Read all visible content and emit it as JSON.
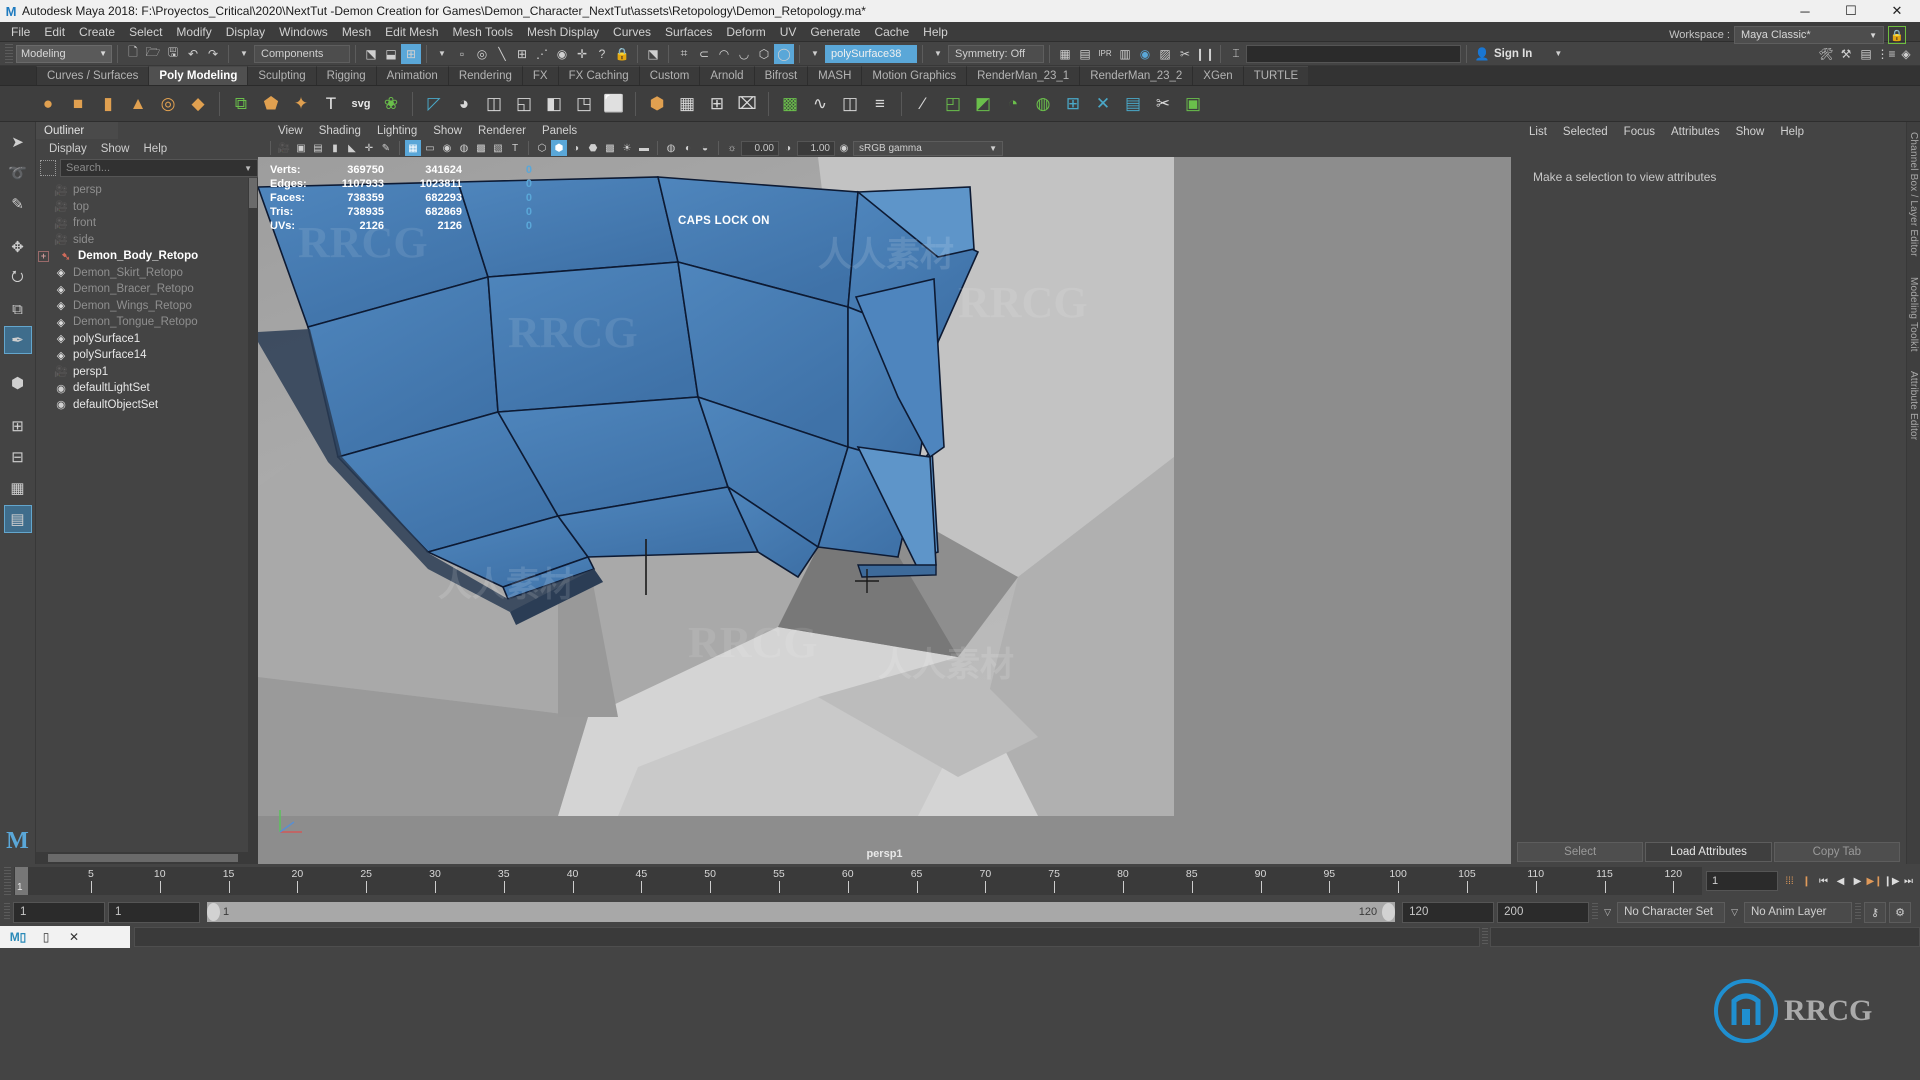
{
  "titlebar": {
    "icon": "maya-logo-icon",
    "text": "Autodesk Maya 2018: F:\\Proyectos_Critical\\2020\\NextTut -Demon Creation for Games\\Demon_Character_NextTut\\assets\\Retopology\\Demon_Retopology.ma*",
    "minimize": "─",
    "maximize": "☐",
    "close": "✕"
  },
  "menubar": {
    "items": [
      "File",
      "Edit",
      "Create",
      "Select",
      "Modify",
      "Display",
      "Windows",
      "Mesh",
      "Edit Mesh",
      "Mesh Tools",
      "Mesh Display",
      "Curves",
      "Surfaces",
      "Deform",
      "UV",
      "Generate",
      "Cache",
      "Help"
    ]
  },
  "statusline": {
    "menuset": "Modeling",
    "file_icons": [
      "new-file-icon",
      "open-file-icon",
      "save-file-icon",
      "undo-icon",
      "redo-icon"
    ],
    "selection_mode_label": "Components",
    "mask_icons": [
      "select-hierarchy-icon",
      "select-object-icon",
      "select-component-icon"
    ],
    "component_icons": [
      "points-icon",
      "circle-icon",
      "line-icon",
      "lattice-icon",
      "curve-point-icon",
      "target-icon",
      "plus-icon",
      "question-icon",
      "lock-icon"
    ],
    "snap_icons": [
      "snap-grid-icon",
      "snap-curve-icon",
      "snap-point-icon",
      "snap-projected-icon",
      "snap-view-plane-icon",
      "make-live-icon"
    ],
    "input_field": "polySurface38",
    "symmetry": "Symmetry: Off",
    "render_icons": [
      "render-current-frame-icon",
      "ipr-render-icon",
      "render-settings-icon",
      "hypershade-icon",
      "render-view-icon",
      "render-setup-icon",
      "pause-icon"
    ],
    "numeric_input_label": "numeric-input-field",
    "workspace_label": "Workspace :",
    "workspace_value": "Maya Classic*",
    "lock_icon": "lock-workspace-icon",
    "signin": "Sign In",
    "panel_icons": [
      "attribute-editor-icon",
      "tool-settings-icon",
      "channel-box-icon",
      "outliner-sidebar-icon",
      "layers-icon"
    ]
  },
  "shelf": {
    "tabs": [
      "Curves / Surfaces",
      "Poly Modeling",
      "Sculpting",
      "Rigging",
      "Animation",
      "Rendering",
      "FX",
      "FX Caching",
      "Custom",
      "Arnold",
      "Bifrost",
      "MASH",
      "Motion Graphics",
      "RenderMan_23_1",
      "RenderMan_23_2",
      "XGen",
      "TURTLE"
    ],
    "active_tab": "Poly Modeling",
    "icons": [
      {
        "name": "poly-sphere-icon",
        "glyph": "●",
        "color": "#e0a050"
      },
      {
        "name": "poly-cube-icon",
        "glyph": "■",
        "color": "#e0a050"
      },
      {
        "name": "poly-cylinder-icon",
        "glyph": "▮",
        "color": "#e0a050"
      },
      {
        "name": "poly-cone-icon",
        "glyph": "▲",
        "color": "#e0a050"
      },
      {
        "name": "poly-torus-icon",
        "glyph": "◎",
        "color": "#e0a050"
      },
      {
        "name": "poly-plane-icon",
        "glyph": "◆",
        "color": "#e0a050"
      },
      {
        "name": "poly-combine-icon",
        "glyph": "⧉",
        "color": "#6abf4b"
      },
      {
        "name": "poly-extrude-icon",
        "glyph": "⬟",
        "color": "#e0a050"
      },
      {
        "name": "poly-bevel-icon",
        "glyph": "✦",
        "color": "#e0a050"
      },
      {
        "name": "poly-text-icon",
        "glyph": "T",
        "color": "#e8e8e8"
      },
      {
        "name": "svg-icon",
        "glyph": "svg",
        "color": "#e8e8e8"
      },
      {
        "name": "poly-smooth-icon",
        "glyph": "❀",
        "color": "#6abf4b"
      },
      {
        "name": "poly-triangulate-icon",
        "glyph": "◸",
        "color": "#4aa8c8"
      },
      {
        "name": "poly-sphere-lit-icon",
        "glyph": "◕",
        "color": "#d8d8d8"
      },
      {
        "name": "poly-bridge-icon",
        "glyph": "◫",
        "color": "#d8d8d8"
      },
      {
        "name": "poly-append-icon",
        "glyph": "◱",
        "color": "#d8d8d8"
      },
      {
        "name": "poly-wedge-icon",
        "glyph": "◧",
        "color": "#d8d8d8"
      },
      {
        "name": "poly-mirror-icon",
        "glyph": "◳",
        "color": "#d8d8d8"
      },
      {
        "name": "poly-boolean-icon",
        "glyph": "⬜",
        "color": "#d8d8d8"
      },
      {
        "name": "poly-reduce-icon",
        "glyph": "⬢",
        "color": "#e0a050"
      },
      {
        "name": "poly-remesh-icon",
        "glyph": "▦",
        "color": "#d8d8d8"
      },
      {
        "name": "poly-retopo-icon",
        "glyph": "⊞",
        "color": "#d8d8d8"
      },
      {
        "name": "poly-crease-icon",
        "glyph": "⌧",
        "color": "#d8d8d8"
      },
      {
        "name": "poly-quad-draw-icon",
        "glyph": "▩",
        "color": "#6abf4b"
      },
      {
        "name": "curve-tool-icon",
        "glyph": "∿",
        "color": "#d8d8d8"
      },
      {
        "name": "poly-insert-loop-icon",
        "glyph": "◫",
        "color": "#d8d8d8"
      },
      {
        "name": "poly-offset-loop-icon",
        "glyph": "≡",
        "color": "#d8d8d8"
      },
      {
        "name": "poly-slide-icon",
        "glyph": "⁄",
        "color": "#d8d8d8"
      },
      {
        "name": "uv-editor-icon",
        "glyph": "◰",
        "color": "#6abf4b"
      },
      {
        "name": "uv-planar-icon",
        "glyph": "◩",
        "color": "#6abf4b"
      },
      {
        "name": "uv-cylindrical-icon",
        "glyph": "◔",
        "color": "#6abf4b"
      },
      {
        "name": "uv-spherical-icon",
        "glyph": "◍",
        "color": "#6abf4b"
      },
      {
        "name": "uv-automatic-icon",
        "glyph": "⊞",
        "color": "#4aa8c8"
      },
      {
        "name": "uv-unfold-icon",
        "glyph": "✕",
        "color": "#4aa8c8"
      },
      {
        "name": "uv-layout-icon",
        "glyph": "▤",
        "color": "#4aa8c8"
      },
      {
        "name": "uv-cut-icon",
        "glyph": "✂",
        "color": "#d8d8d8"
      },
      {
        "name": "uv-snapshot-icon",
        "glyph": "▣",
        "color": "#6abf4b"
      }
    ]
  },
  "lefttools": {
    "items": [
      {
        "name": "select-tool",
        "glyph": "➤"
      },
      {
        "name": "lasso-tool",
        "glyph": "➰"
      },
      {
        "name": "paint-select-tool",
        "glyph": "✎"
      },
      {
        "name": "move-tool",
        "glyph": "✥"
      },
      {
        "name": "rotate-tool",
        "glyph": "⭮"
      },
      {
        "name": "scale-tool",
        "glyph": "⧉"
      },
      {
        "name": "last-tool",
        "glyph": "✒",
        "active": true
      },
      {
        "name": "view-cube-tool",
        "glyph": "⬢"
      },
      {
        "name": "layout-single-tool",
        "glyph": "⊞"
      },
      {
        "name": "layout-two-pane-tool",
        "glyph": "⊟"
      },
      {
        "name": "layout-four-pane-tool",
        "glyph": "▦"
      },
      {
        "name": "layout-persp-outliner-tool",
        "glyph": "▤",
        "active": true
      }
    ],
    "logo": "maya-m-logo"
  },
  "outliner": {
    "title": "Outliner",
    "menus": [
      "Display",
      "Show",
      "Help"
    ],
    "search_placeholder": "Search...",
    "search_icon": "outliner-filter-icon",
    "items": [
      {
        "label": "persp",
        "icon": "camera-icon",
        "style": "dim",
        "indent": 1
      },
      {
        "label": "top",
        "icon": "camera-icon",
        "style": "dim",
        "indent": 1
      },
      {
        "label": "front",
        "icon": "camera-icon",
        "style": "dim",
        "indent": 1
      },
      {
        "label": "side",
        "icon": "camera-icon",
        "style": "dim",
        "indent": 1
      },
      {
        "label": "Demon_Body_Retopo",
        "icon": "transform-arrow-icon",
        "style": "bold",
        "indent": 1,
        "expander": "+"
      },
      {
        "label": "Demon_Skirt_Retopo",
        "icon": "mesh-icon",
        "style": "dim",
        "indent": 1
      },
      {
        "label": "Demon_Bracer_Retopo",
        "icon": "mesh-icon",
        "style": "dim",
        "indent": 1
      },
      {
        "label": "Demon_Wings_Retopo",
        "icon": "mesh-icon",
        "style": "dim",
        "indent": 1
      },
      {
        "label": "Demon_Tongue_Retopo",
        "icon": "mesh-icon",
        "style": "dim",
        "indent": 1
      },
      {
        "label": "polySurface1",
        "icon": "mesh-icon",
        "style": "bright",
        "indent": 1
      },
      {
        "label": "polySurface14",
        "icon": "mesh-icon",
        "style": "bright",
        "indent": 1
      },
      {
        "label": "persp1",
        "icon": "camera-icon",
        "style": "bright",
        "indent": 1
      },
      {
        "label": "defaultLightSet",
        "icon": "set-icon",
        "style": "bright",
        "indent": 1
      },
      {
        "label": "defaultObjectSet",
        "icon": "set-icon",
        "style": "bright",
        "indent": 1
      }
    ]
  },
  "viewport": {
    "menus": [
      "View",
      "Shading",
      "Lighting",
      "Show",
      "Renderer",
      "Panels"
    ],
    "toolbar_icons": [
      {
        "name": "camera-select-icon",
        "glyph": "▶"
      },
      {
        "name": "camera-lock-icon",
        "glyph": "▣"
      },
      {
        "name": "camera-attributes-icon",
        "glyph": "▤"
      },
      {
        "name": "bookmark-icon",
        "glyph": "▮"
      },
      {
        "name": "image-plane-icon",
        "glyph": "◧"
      },
      {
        "name": "two-d-pan-zoom-icon",
        "glyph": "✥"
      },
      {
        "name": "grease-pencil-icon",
        "glyph": "✐"
      },
      {
        "name": "wireframe-icon",
        "glyph": "⊞",
        "on": true
      },
      {
        "name": "smooth-shade-all-icon",
        "glyph": "▢"
      },
      {
        "name": "smooth-shade-selected-icon",
        "glyph": "●"
      },
      {
        "name": "flat-shade-icon",
        "glyph": "○"
      },
      {
        "name": "wireframe-on-shaded-icon",
        "glyph": "░"
      },
      {
        "name": "texture-icon",
        "glyph": "▧"
      },
      {
        "name": "use-default-material-icon",
        "glyph": "T"
      },
      {
        "name": "xray-icon",
        "glyph": "⬡"
      },
      {
        "name": "xray-joints-icon",
        "glyph": "⬢",
        "on": true
      },
      {
        "name": "xray-active-components-icon",
        "glyph": "◑"
      },
      {
        "name": "shadows-icon",
        "glyph": "⬣"
      },
      {
        "name": "screen-space-ao-icon",
        "glyph": "▒"
      },
      {
        "name": "lighting-icon",
        "glyph": "☀"
      },
      {
        "name": "motion-blur-icon",
        "glyph": "▬"
      },
      {
        "name": "multisample-icon",
        "glyph": "●"
      },
      {
        "name": "depth-peeling-icon",
        "glyph": "◐"
      },
      {
        "name": "gamma-icon",
        "glyph": "◒"
      }
    ],
    "exposure_value": "0.00",
    "gamma_value": "1.00",
    "color_space": "sRGB gamma",
    "hud": {
      "columns": 3,
      "rows": [
        {
          "label": "Verts:",
          "total": "369750",
          "selected": "341624",
          "third": "0"
        },
        {
          "label": "Edges:",
          "total": "1107933",
          "selected": "1023811",
          "third": "0"
        },
        {
          "label": "Faces:",
          "total": "738359",
          "selected": "682293",
          "third": "0"
        },
        {
          "label": "Tris:",
          "total": "738935",
          "selected": "682869",
          "third": "0"
        },
        {
          "label": "UVs:",
          "total": "2126",
          "selected": "2126",
          "third": "0"
        }
      ]
    },
    "capslock_message": "CAPS LOCK ON",
    "camera_label": "persp1",
    "axis_gizmo": "axis-gizmo-icon",
    "colors": {
      "selected_mesh": "#4a82ba",
      "selected_mesh_light": "#5e95c9",
      "background_model": "#b4b4b4",
      "hud_accent": "#5aa7d8"
    }
  },
  "attribute_editor": {
    "menus": [
      "List",
      "Selected",
      "Focus",
      "Attributes",
      "Show",
      "Help"
    ],
    "empty_message": "Make a selection to view attributes",
    "buttons": [
      "Select",
      "Load Attributes",
      "Copy Tab"
    ],
    "active_button": "Load Attributes",
    "side_tabs": [
      "Channel Box / Layer Editor",
      "Modeling Toolkit",
      "Attribute Editor"
    ]
  },
  "timeslider": {
    "ticks": [
      5,
      10,
      15,
      20,
      25,
      30,
      35,
      40,
      45,
      50,
      55,
      60,
      65,
      70,
      75,
      80,
      85,
      90,
      95,
      100,
      105,
      110,
      115,
      120
    ],
    "start": 1,
    "end": 120,
    "current_frame": "1",
    "current_frame_field": "1",
    "playback_buttons": [
      {
        "name": "go-to-start-icon",
        "glyph": "⏮"
      },
      {
        "name": "step-back-frame-icon",
        "glyph": "◀"
      },
      {
        "name": "step-back-key-icon",
        "glyph": "⏴"
      },
      {
        "name": "play-backwards-icon",
        "glyph": "◀"
      },
      {
        "name": "play-forwards-icon",
        "glyph": "▶"
      },
      {
        "name": "step-forward-key-icon",
        "glyph": "⏵"
      },
      {
        "name": "step-forward-frame-icon",
        "glyph": "▶"
      },
      {
        "name": "go-to-end-icon",
        "glyph": "⏭"
      }
    ]
  },
  "rangeslider": {
    "anim_start": "1",
    "range_start": "1",
    "bar_start": "1",
    "bar_end": "120",
    "range_end": "120",
    "anim_end": "200",
    "character_set": "No Character Set",
    "anim_layer": "No Anim Layer",
    "auto_key_icon": "auto-key-icon",
    "anim_prefs_icon": "animation-preferences-icon"
  },
  "commandline": {
    "tabs": [
      "mel-tab",
      "script-editor-tab",
      "clear-tab"
    ],
    "input_placeholder": "",
    "output_placeholder": ""
  },
  "watermarks": [
    "RRCG",
    "人人素材"
  ]
}
